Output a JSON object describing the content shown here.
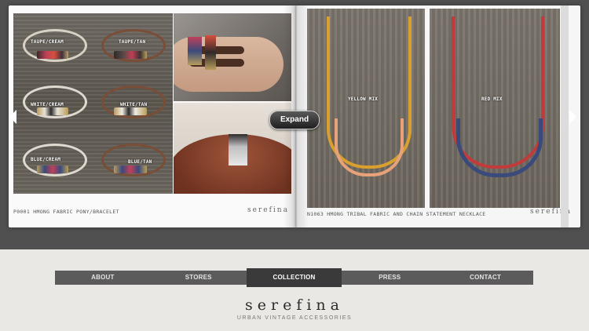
{
  "book": {
    "left_caption": "P0001  HMONG FABRIC PONY/BRACELET",
    "right_caption": "N1063 HMONG TRIBAL FABRIC AND CHAIN STATEMENT NECKLACE",
    "brand_mark": "serefina",
    "bracelet_tags": [
      "TAUPE/CREAM",
      "TAUPE/TAN",
      "WHITE/CREAM",
      "WHITE/TAN",
      "BLUE/CREAM",
      "BLUE/TAN"
    ],
    "necklace_tags": [
      "YELLOW MIX",
      "RED MIX"
    ],
    "expand_label": "Expand"
  },
  "nav": {
    "items": [
      {
        "label": "ABOUT"
      },
      {
        "label": "STORES"
      },
      {
        "label": "COLLECTION"
      },
      {
        "label": "PRESS"
      },
      {
        "label": "CONTACT"
      }
    ],
    "active": "COLLECTION"
  },
  "footer": {
    "logo": "serefina",
    "tagline": "URBAN VINTAGE ACCESSORIES"
  }
}
